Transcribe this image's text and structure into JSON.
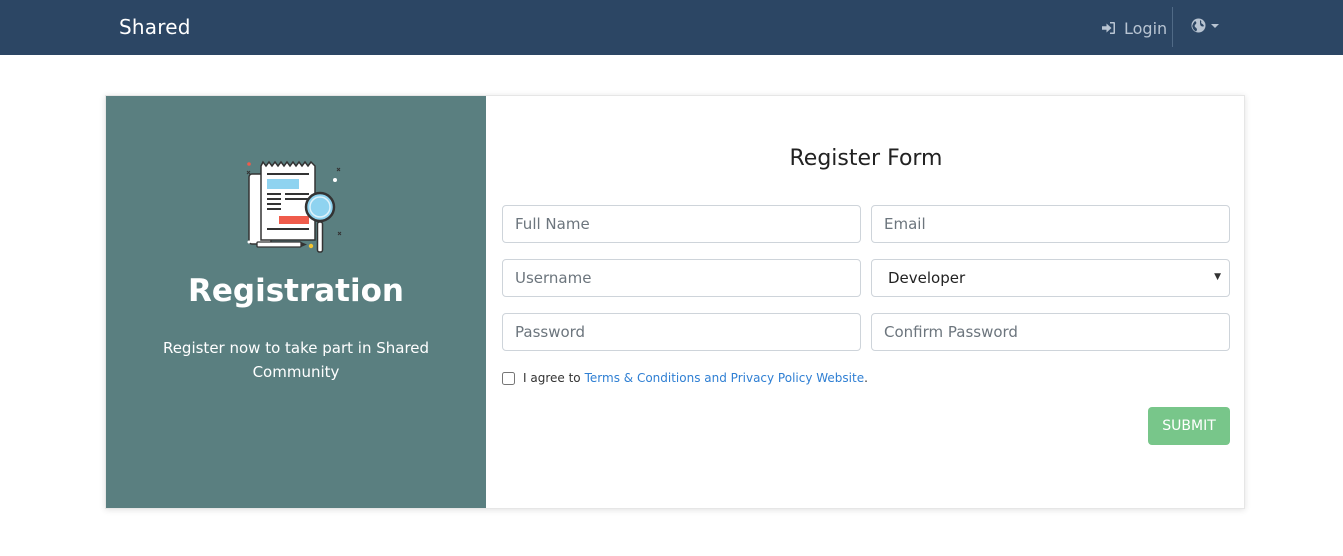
{
  "navbar": {
    "brand": "Shared",
    "login_label": "Login",
    "colors": {
      "background": "#2c4664",
      "text": "#b8c4d2"
    }
  },
  "left_panel": {
    "title": "Registration",
    "subtitle": "Register now to take part in Shared Community",
    "illustration_icon": "document-magnifier-icon",
    "color": "#5a7f80"
  },
  "form": {
    "title": "Register Form",
    "fields": {
      "full_name": {
        "placeholder": "Full Name"
      },
      "email": {
        "placeholder": "Email"
      },
      "username": {
        "placeholder": "Username"
      },
      "role": {
        "selected": "Developer"
      },
      "password": {
        "placeholder": "Password"
      },
      "confirm_password": {
        "placeholder": "Confirm Password"
      }
    },
    "agree_text": "I agree to",
    "terms_link": "Terms & Conditions and Privacy Policy Website",
    "agree_period": ".",
    "submit_label": "SUBMIT",
    "submit_color": "#78c68a",
    "link_color": "#2f7fd3"
  }
}
